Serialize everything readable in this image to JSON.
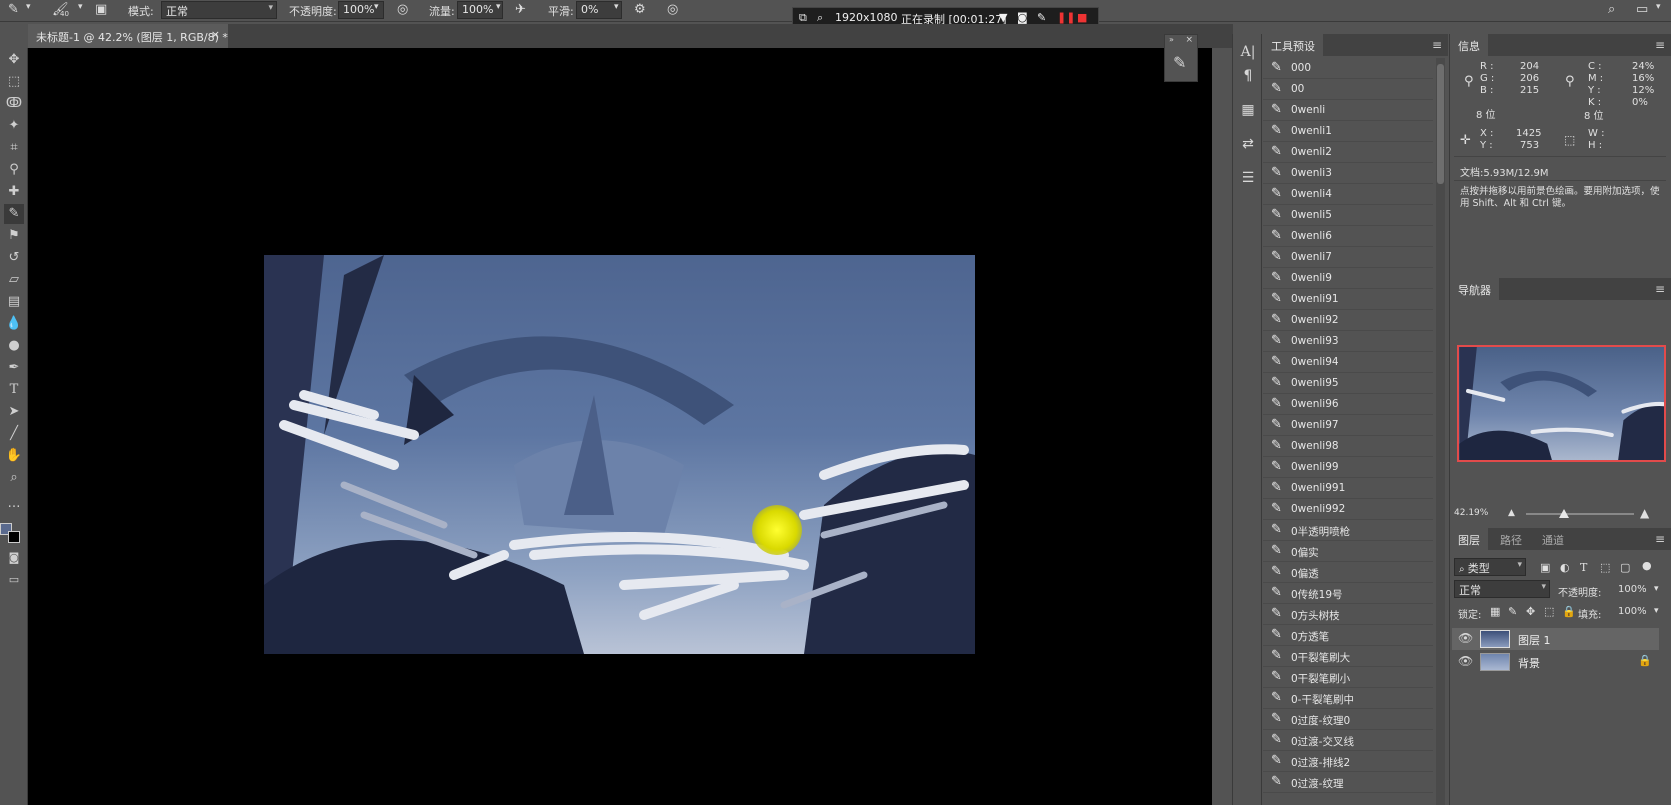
{
  "options_bar": {
    "brush_size": "40",
    "mode_label": "模式:",
    "mode_value": "正常",
    "opacity_label": "不透明度:",
    "opacity_value": "100%",
    "flow_label": "流量:",
    "flow_value": "100%",
    "smooth_label": "平滑:",
    "smooth_value": "0%"
  },
  "recorder": {
    "resolution": "1920x1080",
    "status": "正在录制 [00:01:27]"
  },
  "document_tab": {
    "title": "未标题-1 @ 42.2% (图层 1, RGB/8) *",
    "close": "×"
  },
  "tool_presets": {
    "title": "工具预设",
    "items": [
      "000",
      "00",
      "0wenli",
      "0wenli1",
      "0wenli2",
      "0wenli3",
      "0wenli4",
      "0wenli5",
      "0wenli6",
      "0wenli7",
      "0wenli9",
      "0wenli91",
      "0wenli92",
      "0wenli93",
      "0wenli94",
      "0wenli95",
      "0wenli96",
      "0wenli97",
      "0wenli98",
      "0wenli99",
      "0wenli991",
      "0wenli992",
      "0半透明喷枪",
      "0偏实",
      "0偏透",
      "0传统19号",
      "0方头树枝",
      "0方透笔",
      "0干裂笔刷大",
      "0干裂笔刷小",
      "0-干裂笔刷中",
      "0过度-纹理0",
      "0过渡-交叉线",
      "0过渡-排线2",
      "0过渡-纹理"
    ]
  },
  "info_panel": {
    "title": "信息",
    "r_label": "R :",
    "r_value": "204",
    "g_label": "G :",
    "g_value": "206",
    "b_label": "B :",
    "b_value": "215",
    "bit_left": "8 位",
    "c_label": "C :",
    "c_value": "24%",
    "m_label": "M :",
    "m_value": "16%",
    "y_label": "Y :",
    "y_value": "12%",
    "k_label": "K :",
    "k_value": "0%",
    "bit_right": "8 位",
    "x_label": "X :",
    "x_value": "1425",
    "y2_label": "Y :",
    "y2_value": "753",
    "w_label": "W :",
    "h_label": "H :",
    "doc_size": "文档:5.93M/12.9M",
    "hint": "点按并拖移以用前景色绘画。要用附加选项，使用 Shift、Alt 和 Ctrl 键。"
  },
  "navigator": {
    "title": "导航器",
    "zoom": "42.19%"
  },
  "layers_panel": {
    "tabs": [
      "图层",
      "路径",
      "通道"
    ],
    "kind_label": "类型",
    "blend_mode": "正常",
    "opacity_label": "不透明度:",
    "opacity_value": "100%",
    "lock_label": "锁定:",
    "fill_label": "填充:",
    "fill_value": "100%",
    "layers": [
      {
        "name": "图层 1"
      },
      {
        "name": "背景"
      }
    ]
  },
  "colors": {
    "foreground": "#5a6a8e",
    "background": "#000000",
    "accent": "#e24b4b"
  }
}
